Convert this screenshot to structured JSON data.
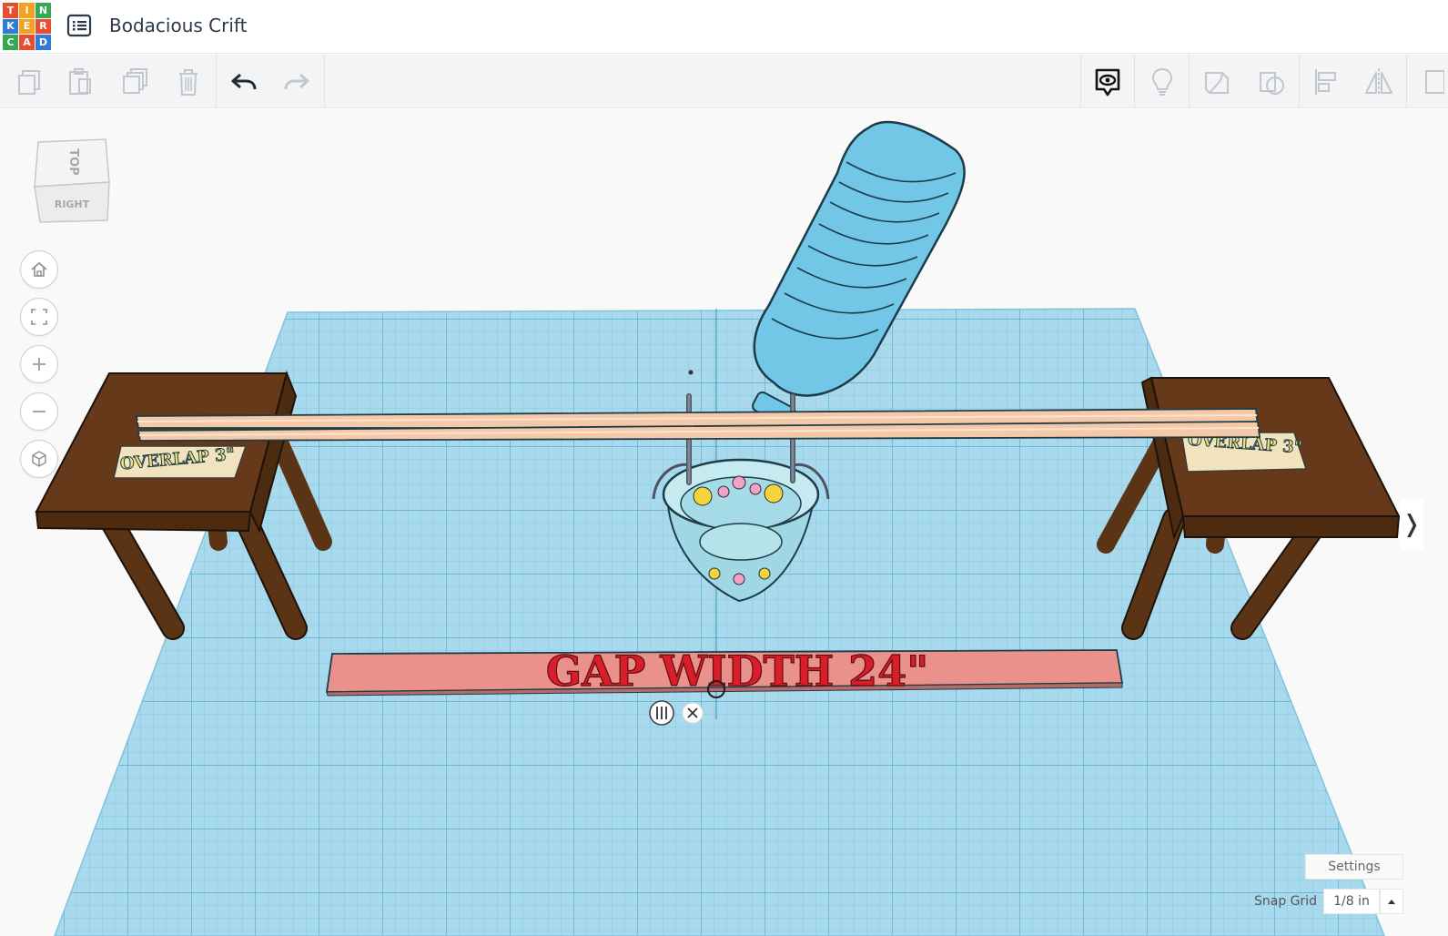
{
  "header": {
    "logo": [
      "T",
      "I",
      "N",
      "K",
      "E",
      "R",
      "C",
      "A",
      "D"
    ],
    "logo_colors": [
      "#e84d2f",
      "#f5a021",
      "#35a852",
      "#2f7bd6",
      "#f5a021",
      "#e84d2f",
      "#35a852",
      "#e84d2f",
      "#2f7bd6"
    ],
    "title": "Bodacious Crift",
    "menu_icon": "list-menu-icon"
  },
  "toolbar": {
    "left_icons": [
      "copy-icon",
      "paste-icon",
      "duplicate-icon",
      "delete-icon",
      "undo-icon",
      "redo-icon"
    ],
    "right_icons": [
      "show-notes-icon",
      "light-bulb-icon",
      "group-icon",
      "ungroup-icon",
      "align-icon",
      "mirror-icon"
    ]
  },
  "viewcube": {
    "top": "TOP",
    "right": "RIGHT"
  },
  "nav_icons": [
    "home-view-icon",
    "fit-all-icon",
    "zoom-in-icon",
    "zoom-out-icon",
    "ortho-perspective-icon"
  ],
  "scene": {
    "overlap_left": "OVERLAP 3\"",
    "overlap_right": "OVERLAP 3\"",
    "gap_label": "GAP WIDTH 24\"",
    "colors": {
      "grid": "#9fd5ea",
      "grid_line": "#6fbad8",
      "table": "#5b3416",
      "table_top": "#66391a",
      "dowel": "#f5c9a8",
      "bottle": "#72c6e6",
      "bucket": "#b8e4ea",
      "bar": "#e9918a",
      "gap_text": "#d81e2a",
      "overlap_text": "#f0e07a"
    }
  },
  "snap": {
    "settings": "Settings",
    "label": "Snap Grid",
    "value": "1/8 in"
  },
  "side_toggle": "❭"
}
